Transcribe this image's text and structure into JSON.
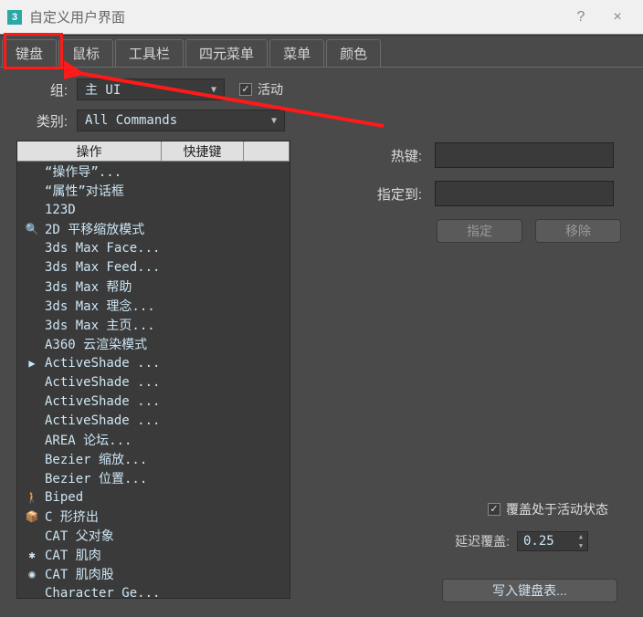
{
  "window": {
    "title": "自定义用户界面",
    "help": "?",
    "close": "×"
  },
  "tabs": [
    {
      "label": "键盘",
      "active": true
    },
    {
      "label": "鼠标",
      "active": false
    },
    {
      "label": "工具栏",
      "active": false
    },
    {
      "label": "四元菜单",
      "active": false
    },
    {
      "label": "菜单",
      "active": false
    },
    {
      "label": "颜色",
      "active": false
    }
  ],
  "group": {
    "label": "组:",
    "value": "主 UI"
  },
  "active_checkbox": {
    "label": "活动",
    "checked": true
  },
  "category": {
    "label": "类别:",
    "value": "All Commands"
  },
  "list": {
    "headers": {
      "op": "操作",
      "hotkey": "快捷键"
    },
    "items": [
      {
        "text": "“操作导”...",
        "icon": ""
      },
      {
        "text": "“属性”对话框",
        "icon": ""
      },
      {
        "text": "123D",
        "icon": ""
      },
      {
        "text": "2D 平移缩放模式",
        "icon": "🔍"
      },
      {
        "text": "3ds Max Face...",
        "icon": ""
      },
      {
        "text": "3ds Max Feed...",
        "icon": ""
      },
      {
        "text": "3ds Max 帮助",
        "icon": ""
      },
      {
        "text": "3ds Max 理念...",
        "icon": ""
      },
      {
        "text": "3ds Max 主页...",
        "icon": ""
      },
      {
        "text": "A360 云渲染模式",
        "icon": ""
      },
      {
        "text": "ActiveShade ...",
        "icon": "▶"
      },
      {
        "text": "ActiveShade ...",
        "icon": ""
      },
      {
        "text": "ActiveShade ...",
        "icon": ""
      },
      {
        "text": "ActiveShade ...",
        "icon": ""
      },
      {
        "text": "AREA 论坛...",
        "icon": ""
      },
      {
        "text": "Bezier 缩放...",
        "icon": ""
      },
      {
        "text": "Bezier 位置...",
        "icon": ""
      },
      {
        "text": "Biped",
        "icon": "🚶"
      },
      {
        "text": "C 形挤出",
        "icon": "📦"
      },
      {
        "text": "CAT 父对象",
        "icon": ""
      },
      {
        "text": "CAT 肌肉",
        "icon": "✱"
      },
      {
        "text": "CAT 肌肉股",
        "icon": "◉"
      },
      {
        "text": "Character Ge...",
        "icon": ""
      }
    ]
  },
  "hotkey": {
    "label": "热键:"
  },
  "assigned": {
    "label": "指定到:"
  },
  "buttons": {
    "assign": "指定",
    "remove": "移除"
  },
  "override": {
    "label": "覆盖处于活动状态",
    "checked": true
  },
  "delay": {
    "label": "延迟覆盖:",
    "value": "0.25"
  },
  "write_btn": "写入键盘表..."
}
